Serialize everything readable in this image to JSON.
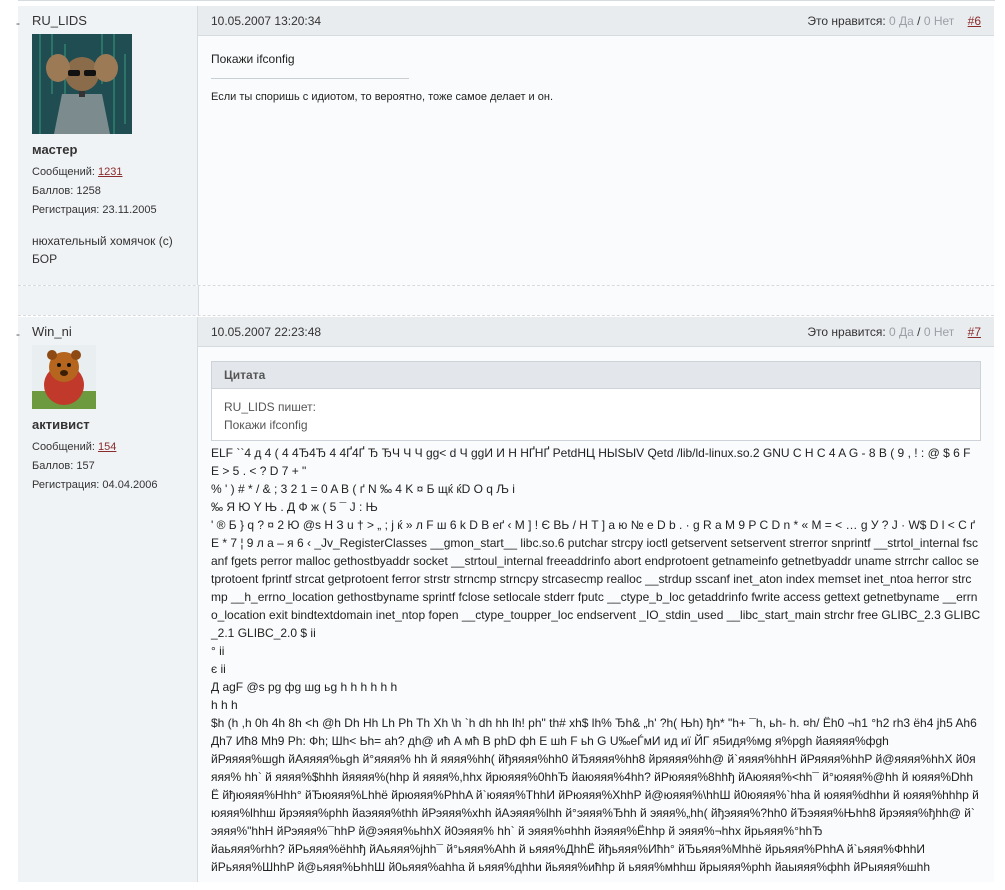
{
  "posts": [
    {
      "username": "RU_LIDS",
      "rank": "мастер",
      "messages_label": "Сообщений:",
      "messages": "1231",
      "points": "Баллов: 1258",
      "registered": "Регистрация: 23.11.2005",
      "side_signature": "нюхательный хомячок (с) БОР",
      "date": "10.05.2007 13:20:34",
      "likes_label": "Это нравится:",
      "yes": "0 Да",
      "slash": "/",
      "no": "0 Нет",
      "number": "#6",
      "text": "Покажи ifconfig",
      "signature": "Если ты споришь с идиотом, то вероятно, тоже самое делает и он."
    },
    {
      "username": "Win_ni",
      "rank": "активист",
      "messages_label": "Сообщений:",
      "messages": "154",
      "points": "Баллов: 157",
      "registered": "Регистрация: 04.04.2006",
      "date": "10.05.2007 22:23:48",
      "likes_label": "Это нравится:",
      "yes": "0 Да",
      "slash": "/",
      "no": "0 Нет",
      "number": "#7",
      "quote_title": "Цитата",
      "quote_author": "RU_LIDS пишет:",
      "quote_text": "Покажи ifconfig",
      "garbage_lines": [
        "ELF ``4 д 4 (  4 4Ђ4Ђ 4 4Ґ4Ґ  Ђ ЂЧ Ч  Ч gg< d  Ч ggИ И Н НҐНҐ PetdНЦ НЫЅЫV  Qetd /lib/ld-linux.so.2  GNU C H C 4 A G - 8 B  ( 9 , ! : @  $ 6 F E > 5  .    < ? D 7 + \"",
        "  % ' )   # * / & ; 3 2 1 = 0 A B  ( ґ  N ‰  4 K ¤ Б  щќ  ќD  O q  Љ і",
        "‰  Я Ю  Y Њ  . Д  Ф ж  ( 5  ¯ J  :  Њ",
        "  ' ® Б  }  q ?  ¤ 2 Ю @s  Н З u † >  „  ; j  ќ »  л F  ш 6  k D  В  еґ  ‹ M ] ! Є  ВЬ  /    Н T ] а ю №  e D  b .  · g  R a  M  9 P  C   D n * « M = < … g  У ?  J ·  W$  D  l <   C ґ  E *  7 ¦ 9  л а – я  6 ‹  _Jv_RegisterClasses __gmon_start__ libc.so.6 putchar strcpy ioctl getservent setservent strerror snprintf __strtol_internal fscanf fgets perror malloc gethostbyaddr socket __strtoul_internal freeaddrinfo abort endprotoent getnameinfo getnetbyaddr uname strrchr calloc setprotoent fprintf strcat getprotoent ferror strstr strncmp strncpy strcasecmp realloc __strdup sscanf inet_aton index memset inet_ntoa herror strcmp __h_errno_location gethostbyname sprintf fclose setlocale stderr fputc __ctype_b_loc getaddrinfo fwrite access gettext getnetbyname __errno_location exit bindtextdomain inet_ntop fopen __ctype_toupper_loc endservent _IO_stdin_used __libc_start_main strchr free GLIBC_2.3 GLIBC_2.1 GLIBC_2.0 $  ii",
        "°  ii",
        "є  ii",
        "Д agF @s pg фg шg ьg h h h h h h",
        "h h h",
        "$h (h ,h 0h 4h 8h <h @h Dh Hh Lh Ph Th Xh \\h `h dh hh lh! ph\" th# xh$ lh% Ђh& „h' ?h( Њh) ђh* \"h+ ¯h, ьh- h. ¤h/ Ёh0 ¬h1 °h2 rh3 ёh4 jh5 Ah6 Дh7 Ић8 Mh9 Ph: Фh; Шh< Ьh= ah? дh@ ић A мћ B phD фh E шh F ьh G U‰еЃмИ ид иї ЙГ я5идя%мg я%pgh йаяяяя%фgh",
        "йРяяяя%шgh йАяяяя%ьgh й°яяяя% hh й яяяя%hh( йђяяяя%hh0 йЂяяяя%hh8 йряяяя%hh@ й`яяяя%hhH йРяяяя%hhP й@яяяя%hhX й0яяяя% hh` й яяяя%$hhh йяяяя%(hhp й яяяя%,hhx йрюяяя%0hhЂ йаюяяя%4hh? йРюяяя%8hhђ йАюяяя%<hh¯ й°юяяя%@hh й юяяя%DhhЁ йђюяяя%Hhh° йЂюяяя%Lhhё йрюяяя%PhhA й`юяяя%ThhИ йРюяяя%XhhP й@юяяя%\\hhШ й0юяяя%`hha й юяяя%dhhи й юяяя%hhhp й юяяя%lhhш йрэяяя%phh йаэяяя%thh йРэяяя%xhh йАэяяя%lhh й°эяяя%Ђhh й эяяя%„hh( йђэяяя%?hh0 йЂэяяя%Њhh8 йрэяяя%ђhh@ й`эяяя%\"hhH йРэяяя%¯hhP й@эяяя%ьhhX й0эяяя% hh` й эяяя%¤hhh йэяяя%Ёhhp й эяяя%¬hhx йрьяяя%°hhЂ",
        "йаьяяя%rhh? йРьяяя%ёhhђ йАьяяя%jhh¯ й°ьяяя%Ahh й ьяяя%ДhhЁ йђьяяя%Ићh° йЂьяяя%Mhhё йрьяяя%PhhA й`ьяяя%ФhhИ",
        "йРьяяя%ШhhP й@ьяяя%ЬhhШ й0ьяяя%ahha й ьяяя%дhhи йьяяя%ићhp й ьяяя%мhhш йрыяяя%phh йаыяяя%фhh йРыяяя%шhh"
      ]
    }
  ]
}
